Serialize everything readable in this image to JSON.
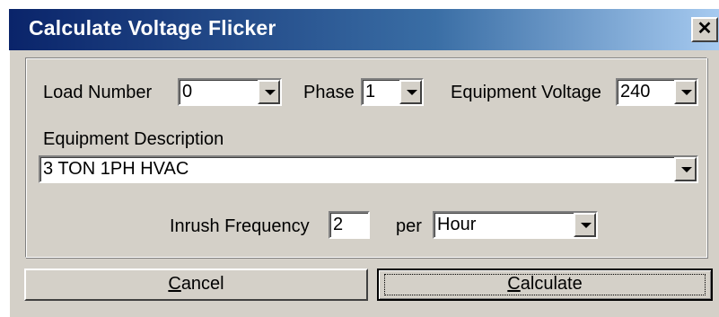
{
  "window": {
    "title": "Calculate Voltage Flicker",
    "close_glyph": "✕"
  },
  "form": {
    "load_number": {
      "label": "Load Number",
      "value": "0"
    },
    "phase": {
      "label": "Phase",
      "value": "1"
    },
    "equipment_voltage": {
      "label": "Equipment Voltage",
      "value": "240"
    },
    "equipment_description": {
      "label": "Equipment Description",
      "value": "3 TON 1PH HVAC"
    },
    "inrush_frequency": {
      "label": "Inrush Frequency",
      "value": "2",
      "per_label": "per",
      "unit_value": "Hour"
    }
  },
  "buttons": {
    "cancel": {
      "accel": "C",
      "rest": "ancel"
    },
    "calculate": {
      "accel": "C",
      "rest": "alculate"
    }
  }
}
